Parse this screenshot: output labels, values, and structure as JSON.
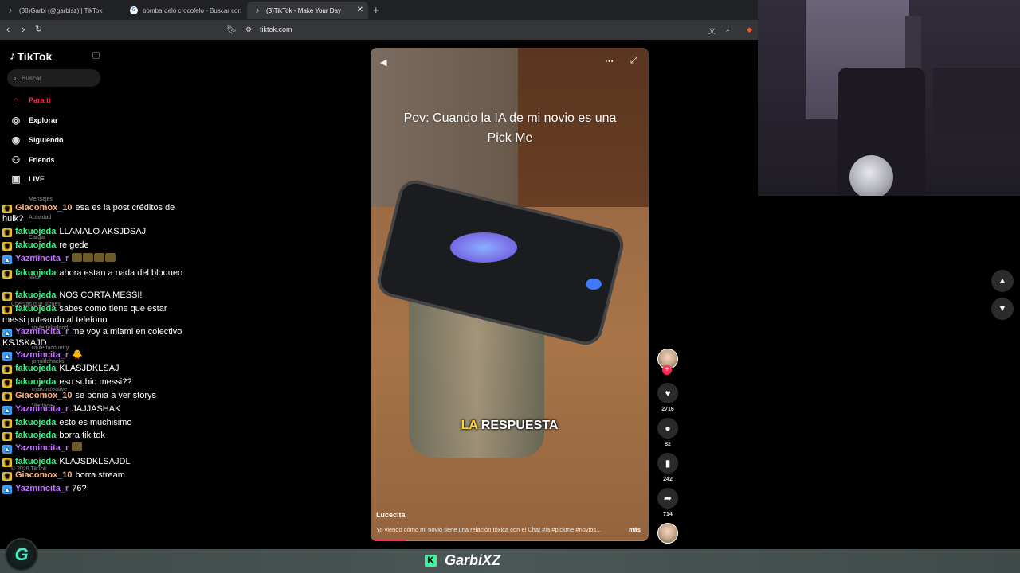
{
  "browser": {
    "tabs": [
      {
        "icon": "tiktok-icon",
        "label": "(38)Garbi (@garbisz) | TikTok",
        "active": false
      },
      {
        "icon": "google-icon",
        "label": "bombardelo crocofelo - Buscar con G",
        "active": false
      },
      {
        "icon": "tiktok-icon",
        "label": "(3)TikTok - Make Your Day",
        "active": true
      }
    ],
    "new_tab": "+",
    "url": "tiktok.com"
  },
  "sidebar": {
    "logo": "TikTok",
    "search_placeholder": "Buscar",
    "items": [
      {
        "label": "Para ti",
        "icon": "home-icon",
        "active": true
      },
      {
        "label": "Explorar",
        "icon": "compass-icon"
      },
      {
        "label": "Siguiendo",
        "icon": "following-icon"
      },
      {
        "label": "Friends",
        "icon": "friends-icon"
      },
      {
        "label": "LIVE",
        "icon": "live-icon"
      }
    ],
    "hidden_items": [
      "Mensajes",
      "Actividad",
      "Cargar",
      "Perfil",
      "Más"
    ],
    "following_header": "Cuentas que sigues",
    "following": [
      "rouletteforfood",
      "roulettacountry",
      "johnlifehacks",
      "marcocreative"
    ],
    "see_all": "Ver todo",
    "copyright": "© 2026 TikTok"
  },
  "chat": [
    {
      "badge": "crown",
      "user": "Giacomox_10",
      "user_color": "#ffb37a",
      "text": "esa es la post créditos de hulk?",
      "emotes": 0
    },
    {
      "badge": "crown",
      "user": "fakuojeda",
      "user_color": "#3df08a",
      "text": "LLAMALO AKSJDSAJ",
      "emotes": 0
    },
    {
      "badge": "crown",
      "user": "fakuojeda",
      "user_color": "#3df08a",
      "text": "re gede",
      "emotes": 0
    },
    {
      "badge": "prime",
      "user": "Yazmincita_r",
      "user_color": "#c070ff",
      "text": "",
      "emotes": 4
    },
    {
      "badge": "crown",
      "user": "fakuojeda",
      "user_color": "#3df08a",
      "text": "ahora estan a nada del bloqueo",
      "emotes": 0
    },
    {
      "badge": "crown",
      "user": "fakuojeda",
      "user_color": "#3df08a",
      "text": "NOS CORTA MESSI!",
      "emotes": 0
    },
    {
      "badge": "crown",
      "user": "fakuojeda",
      "user_color": "#3df08a",
      "text": "sabes como tiene que estar messi puteando al telefono",
      "emotes": 0
    },
    {
      "badge": "prime",
      "user": "Yazmincita_r",
      "user_color": "#c070ff",
      "text": "me voy a miami en colectivo KSJSKAJD",
      "emotes": 0
    },
    {
      "badge": "prime",
      "user": "Yazmincita_r",
      "user_color": "#c070ff",
      "text": "🐥",
      "emotes": 0
    },
    {
      "badge": "crown",
      "user": "fakuojeda",
      "user_color": "#3df08a",
      "text": "KLASJDKLSAJ",
      "emotes": 0
    },
    {
      "badge": "crown",
      "user": "fakuojeda",
      "user_color": "#3df08a",
      "text": "eso subio messi??",
      "emotes": 0
    },
    {
      "badge": "crown",
      "user": "Giacomox_10",
      "user_color": "#ffb37a",
      "text": "se ponia a ver storys",
      "emotes": 0
    },
    {
      "badge": "prime",
      "user": "Yazmincita_r",
      "user_color": "#c070ff",
      "text": "JAJJASHAK",
      "emotes": 0
    },
    {
      "badge": "crown",
      "user": "fakuojeda",
      "user_color": "#3df08a",
      "text": "esto es muchisimo",
      "emotes": 0
    },
    {
      "badge": "crown",
      "user": "fakuojeda",
      "user_color": "#3df08a",
      "text": "borra tik tok",
      "emotes": 0
    },
    {
      "badge": "prime",
      "user": "Yazmincita_r",
      "user_color": "#c070ff",
      "text": "",
      "emotes": 1
    },
    {
      "badge": "crown",
      "user": "fakuojeda",
      "user_color": "#3df08a",
      "text": "KLAJSDKLSAJDL",
      "emotes": 0
    },
    {
      "badge": "crown",
      "user": "Giacomox_10",
      "user_color": "#ffb37a",
      "text": "borra stream",
      "emotes": 0
    },
    {
      "badge": "prime",
      "user": "Yazmincita_r",
      "user_color": "#c070ff",
      "text": "76?",
      "emotes": 0
    }
  ],
  "video": {
    "caption": "Pov: Cuando la IA de mi novio es una Pick Me",
    "subtitle_highlight": "LA",
    "subtitle_rest": "RESPUESTA",
    "author": "Lucecita",
    "description": "Yo viendo cómo mi novio tiene una relación tóxica con el Chat #ia #pickme #novios...",
    "more": "más",
    "progress": 0.13
  },
  "actions": {
    "likes": "2716",
    "comments": "82",
    "saves": "242",
    "shares": "714"
  },
  "stream": {
    "logo_letter": "G",
    "platform_letter": "K",
    "streamer": "GarbiXZ"
  },
  "colors": {
    "accent": "#fe2c55",
    "kick_green": "#3ff2a0"
  }
}
